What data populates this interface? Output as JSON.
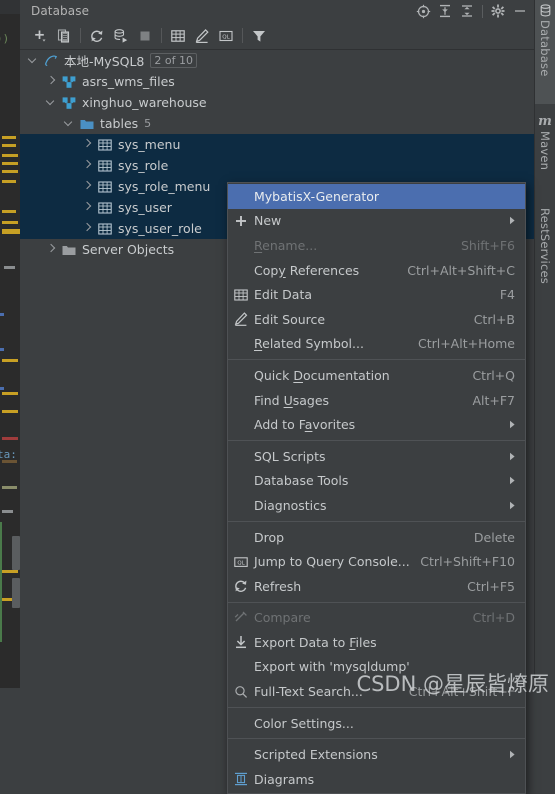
{
  "window": {
    "title": "Database",
    "header_icons": [
      {
        "name": "locate-icon",
        "label": "Locate Data Source"
      },
      {
        "name": "expand-all-icon",
        "label": "Expand All"
      },
      {
        "name": "collapse-all-icon",
        "label": "Collapse All"
      },
      {
        "name": "gear-icon",
        "label": "Options"
      },
      {
        "name": "minimize-icon",
        "label": "Hide"
      }
    ]
  },
  "toolbar": {
    "items": [
      {
        "name": "add-icon",
        "label": "New"
      },
      {
        "name": "duplicate-icon",
        "label": "Duplicate"
      },
      {
        "name": "refresh-icon",
        "label": "Refresh"
      },
      {
        "name": "run-script-icon",
        "label": "Run SQL Script"
      },
      {
        "name": "stop-icon",
        "label": "Stop"
      },
      {
        "name": "table-grid-icon",
        "label": "Data Editor"
      },
      {
        "name": "pencil-icon",
        "label": "Modify"
      },
      {
        "name": "query-console-icon",
        "label": "Open Query Console"
      },
      {
        "name": "filter-icon",
        "label": "Filter"
      }
    ]
  },
  "tree": {
    "nodes": [
      {
        "label": "本地-MySQL8",
        "badge": "2 of 10",
        "icon": "mysql-datasource-icon",
        "expanded": true,
        "indent": 0,
        "selected": false
      },
      {
        "label": "asrs_wms_files",
        "badge": "",
        "icon": "schema-icon",
        "expanded": false,
        "indent": 1,
        "selected": false
      },
      {
        "label": "xinghuo_warehouse",
        "badge": "",
        "icon": "schema-icon",
        "expanded": true,
        "indent": 1,
        "selected": false
      },
      {
        "label": "tables",
        "badge": "5",
        "icon": "folder-icon",
        "expanded": true,
        "indent": 2,
        "selected": false
      },
      {
        "label": "sys_menu",
        "badge": "",
        "icon": "table-icon",
        "expanded": false,
        "indent": 3,
        "selected": true
      },
      {
        "label": "sys_role",
        "badge": "",
        "icon": "table-icon",
        "expanded": false,
        "indent": 3,
        "selected": true
      },
      {
        "label": "sys_role_menu",
        "badge": "",
        "icon": "table-icon",
        "expanded": false,
        "indent": 3,
        "selected": true
      },
      {
        "label": "sys_user",
        "badge": "",
        "icon": "table-icon",
        "expanded": false,
        "indent": 3,
        "selected": true
      },
      {
        "label": "sys_user_role",
        "badge": "",
        "icon": "table-icon",
        "expanded": false,
        "indent": 3,
        "selected": true
      },
      {
        "label": "Server Objects",
        "badge": "",
        "icon": "folder-grey-icon",
        "expanded": false,
        "indent": 1,
        "selected": false
      }
    ]
  },
  "context_menu": {
    "items": [
      {
        "type": "item",
        "label": "MybatisX-Generator",
        "accel": "",
        "icon": "",
        "state": "highlighted",
        "submenu": false
      },
      {
        "type": "item",
        "label": "New",
        "accel": "",
        "icon": "plus-icon",
        "state": "normal",
        "submenu": true
      },
      {
        "type": "item",
        "label": "Rename...",
        "accel": "Shift+F6",
        "icon": "",
        "state": "disabled",
        "submenu": false,
        "mnemonic": 0
      },
      {
        "type": "item",
        "label": "Copy References",
        "accel": "Ctrl+Alt+Shift+C",
        "icon": "",
        "state": "normal",
        "submenu": false,
        "mnemonic": 3
      },
      {
        "type": "item",
        "label": "Edit Data",
        "accel": "F4",
        "icon": "table-grid-icon",
        "state": "normal",
        "submenu": false
      },
      {
        "type": "item",
        "label": "Edit Source",
        "accel": "Ctrl+B",
        "icon": "pencil-icon",
        "state": "normal",
        "submenu": false
      },
      {
        "type": "item",
        "label": "Related Symbol...",
        "accel": "Ctrl+Alt+Home",
        "icon": "",
        "state": "normal",
        "submenu": false,
        "mnemonic": 0
      },
      {
        "type": "separator"
      },
      {
        "type": "item",
        "label": "Quick Documentation",
        "accel": "Ctrl+Q",
        "icon": "",
        "state": "normal",
        "submenu": false,
        "mnemonic": 6
      },
      {
        "type": "item",
        "label": "Find Usages",
        "accel": "Alt+F7",
        "icon": "",
        "state": "normal",
        "submenu": false,
        "mnemonic": 5
      },
      {
        "type": "item",
        "label": "Add to Favorites",
        "accel": "",
        "icon": "",
        "state": "normal",
        "submenu": true,
        "mnemonic": 8
      },
      {
        "type": "separator"
      },
      {
        "type": "item",
        "label": "SQL Scripts",
        "accel": "",
        "icon": "",
        "state": "normal",
        "submenu": true
      },
      {
        "type": "item",
        "label": "Database Tools",
        "accel": "",
        "icon": "",
        "state": "normal",
        "submenu": true
      },
      {
        "type": "item",
        "label": "Diagnostics",
        "accel": "",
        "icon": "",
        "state": "normal",
        "submenu": true
      },
      {
        "type": "separator"
      },
      {
        "type": "item",
        "label": "Drop",
        "accel": "Delete",
        "icon": "",
        "state": "normal",
        "submenu": false
      },
      {
        "type": "item",
        "label": "Jump to Query Console...",
        "accel": "Ctrl+Shift+F10",
        "icon": "query-console-icon",
        "state": "normal",
        "submenu": false
      },
      {
        "type": "item",
        "label": "Refresh",
        "accel": "Ctrl+F5",
        "icon": "refresh-icon",
        "state": "normal",
        "submenu": false
      },
      {
        "type": "separator"
      },
      {
        "type": "item",
        "label": "Compare",
        "accel": "Ctrl+D",
        "icon": "compare-icon",
        "state": "disabled",
        "submenu": false
      },
      {
        "type": "item",
        "label": "Export Data to Files",
        "accel": "",
        "icon": "export-icon",
        "state": "normal",
        "submenu": false,
        "mnemonic": 15
      },
      {
        "type": "item",
        "label": "Export with 'mysqldump'",
        "accel": "",
        "icon": "",
        "state": "normal",
        "submenu": false
      },
      {
        "type": "item",
        "label": "Full-Text Search...",
        "accel": "Ctrl+Alt+Shift+F",
        "icon": "search-icon",
        "state": "normal",
        "submenu": false
      },
      {
        "type": "separator"
      },
      {
        "type": "item",
        "label": "Color Settings...",
        "accel": "",
        "icon": "",
        "state": "normal",
        "submenu": false
      },
      {
        "type": "separator"
      },
      {
        "type": "item",
        "label": "Scripted Extensions",
        "accel": "",
        "icon": "",
        "state": "normal",
        "submenu": true
      },
      {
        "type": "item",
        "label": "Diagrams",
        "accel": "",
        "icon": "diagram-icon",
        "state": "normal",
        "submenu": false
      }
    ]
  },
  "right_stripe": {
    "items": [
      {
        "label": "Database",
        "icon": "database-icon",
        "active": true
      },
      {
        "label": "Maven",
        "icon": "maven-icon",
        "active": false
      },
      {
        "label": "RestServices",
        "icon": "",
        "active": false
      }
    ]
  },
  "editor_sliver": {
    "code_fragment": "))",
    "label_fragment": "ta:"
  },
  "watermark": {
    "text": "CSDN @星辰皆燎原"
  },
  "colors": {
    "panel_bg": "#3c3f41",
    "editor_bg": "#2b2b2b",
    "selection_bg": "#0d2b42",
    "menu_highlight": "#4b6eaf",
    "text": "#c9ccce",
    "muted_text": "#9a9da0",
    "accent_cyan": "#4f9fd0",
    "folder_blue": "#4a90c4",
    "code_yellow": "#c8a024"
  }
}
